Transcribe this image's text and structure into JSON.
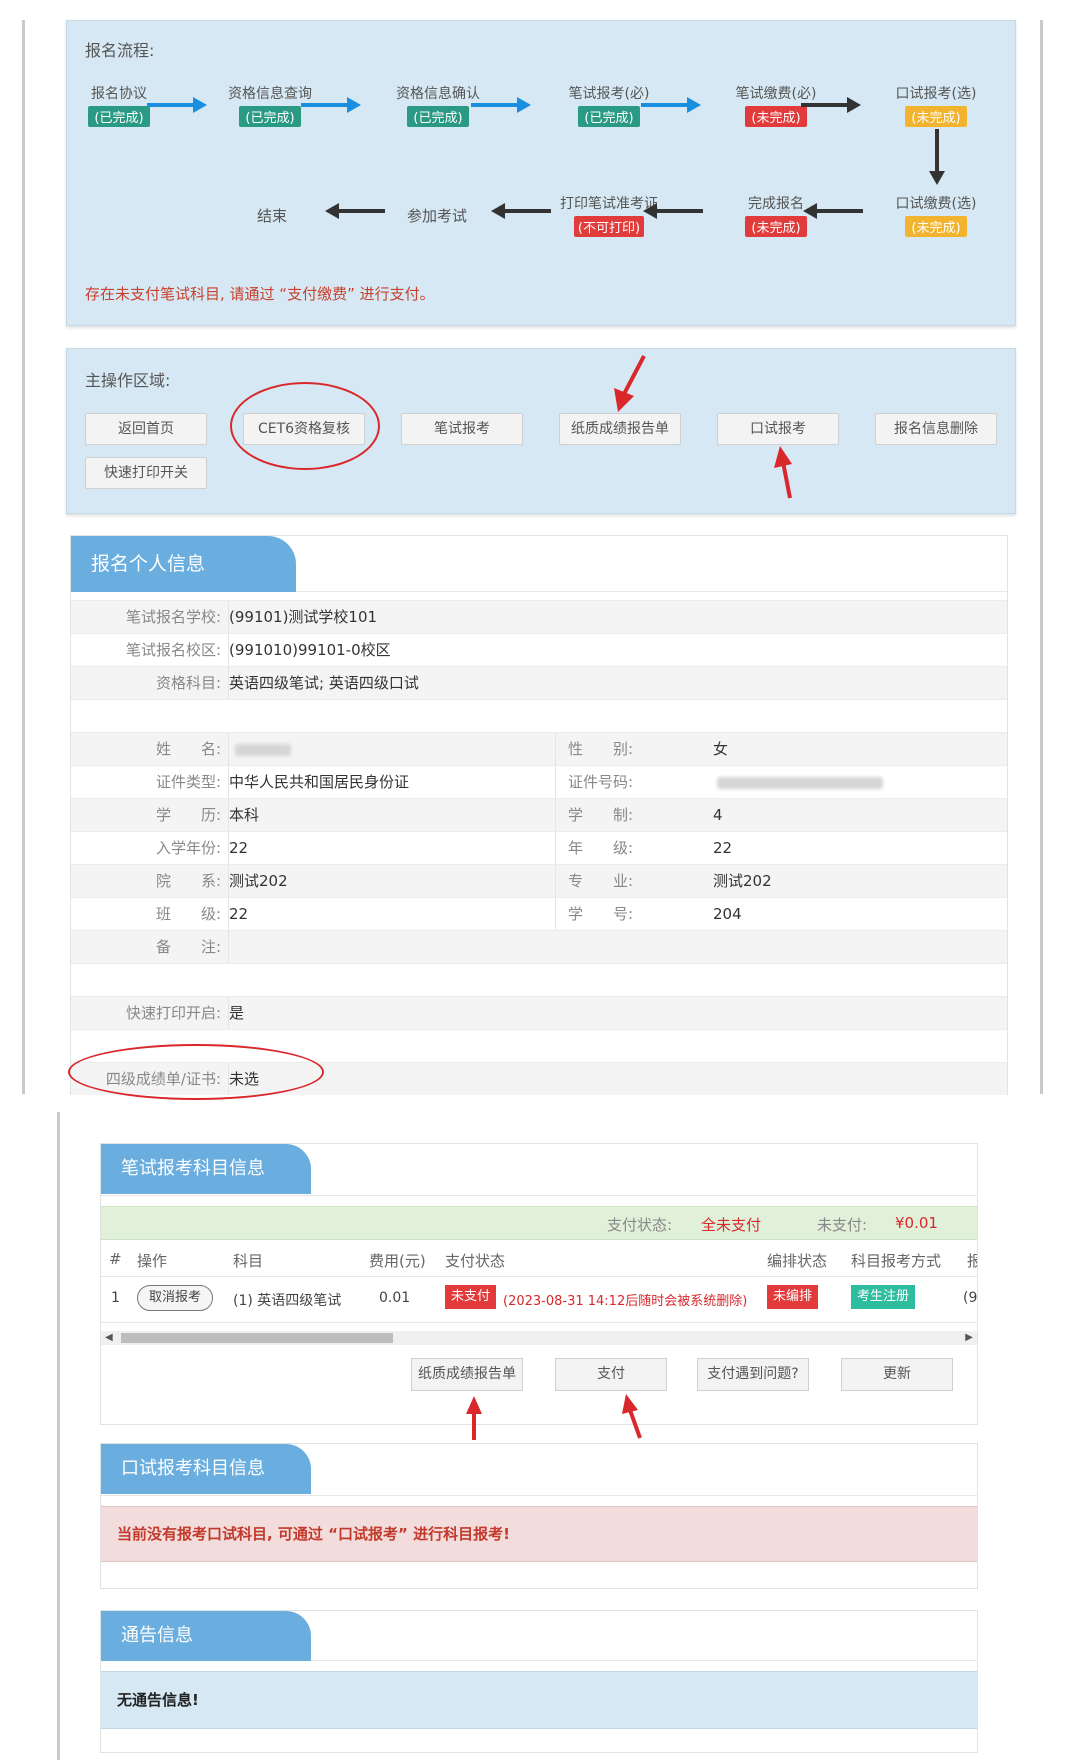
{
  "flow": {
    "title": "报名流程:",
    "steps": [
      {
        "label": "报名协议",
        "status": "(已完成)"
      },
      {
        "label": "资格信息查询",
        "status": "(已完成)"
      },
      {
        "label": "资格信息确认",
        "status": "(已完成)"
      },
      {
        "label": "笔试报考(必)",
        "status": "(已完成)"
      },
      {
        "label": "笔试缴费(必)",
        "status": "(未完成)"
      },
      {
        "label": "口试报考(选)",
        "status": "(未完成)"
      },
      {
        "label": "口试缴费(选)",
        "status": "(未完成)"
      },
      {
        "label": "完成报名",
        "status": "(未完成)"
      },
      {
        "label": "打印笔试准考证",
        "status": "(不可打印)"
      },
      {
        "label": "参加考试",
        "status": ""
      },
      {
        "label": "结束",
        "status": ""
      }
    ],
    "warning": "存在未支付笔试科目, 请通过 “支付缴费” 进行支付。"
  },
  "ops": {
    "title": "主操作区域:",
    "buttons": [
      "返回首页",
      "CET6资格复核",
      "笔试报考",
      "纸质成绩报告单",
      "口试报考",
      "报名信息删除",
      "快速打印开关"
    ]
  },
  "personal": {
    "header": "报名个人信息",
    "school_label": "笔试报名学校:",
    "school": "(99101)测试学校101",
    "campus_label": "笔试报名校区:",
    "campus": "(991010)99101-0校区",
    "subjects_label": "资格科目:",
    "subjects": "英语四级笔试; 英语四级口试",
    "name_label": "姓　　名:",
    "gender_label": "性　　别:",
    "gender": "女",
    "idtype_label": "证件类型:",
    "idtype": "中华人民共和国居民身份证",
    "idno_label": "证件号码:",
    "edu_label": "学　　历:",
    "edu": "本科",
    "years_label": "学　　制:",
    "years": "4",
    "enroll_label": "入学年份:",
    "enroll": "22",
    "grade_label": "年　　级:",
    "grade": "22",
    "dept_label": "院　　系:",
    "dept": "测试202",
    "major_label": "专　　业:",
    "major": "测试202",
    "class_label": "班　　级:",
    "class": "22",
    "stuno_label": "学　　号:",
    "stuno": "204",
    "remark_label": "备　　注:",
    "quickprint_label": "快速打印开启:",
    "quickprint": "是",
    "cert_label": "四级成绩单/证书:",
    "cert": "未选"
  },
  "written": {
    "header": "笔试报考科目信息",
    "pay_status_label": "支付状态:",
    "pay_status": "全未支付",
    "unpaid_label": "未支付:",
    "unpaid": "¥0.01",
    "columns": [
      "#",
      "操作",
      "科目",
      "费用(元)",
      "支付状态",
      "编排状态",
      "科目报考方式",
      "报"
    ],
    "row": {
      "index": "1",
      "action": "取消报考",
      "subject": "(1) 英语四级笔试",
      "fee": "0.01",
      "pay_tag": "未支付",
      "pay_note": "(2023-08-31 14:12后随时会被系统删除)",
      "arrange_tag": "未编排",
      "method_tag": "考生注册",
      "extra": "(9"
    },
    "buttons": [
      "纸质成绩报告单",
      "支付",
      "支付遇到问题?",
      "更新"
    ]
  },
  "oral": {
    "header": "口试报考科目信息",
    "warning": "当前没有报考口试科目, 可通过 “口试报考” 进行科目报考!"
  },
  "notice": {
    "header": "通告信息",
    "text": "无通告信息!"
  },
  "colors": {
    "panel_blue": "#d6e8f3",
    "tab_blue": "#6aaee0",
    "done_green": "#2a9a84",
    "todo_red": "#e23b3b",
    "optional_yellow": "#f2b42e",
    "annotation_red": "#d9282b"
  }
}
